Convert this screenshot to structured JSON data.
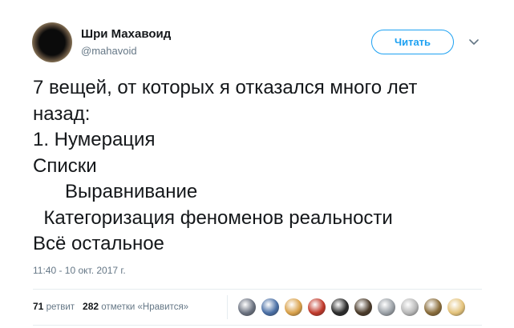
{
  "tweet": {
    "author_name": "Шри Махавоид",
    "author_handle": "@mahavoid",
    "follow_label": "Читать",
    "text_lines": [
      "7 вещей, от которых я отказался много лет",
      "назад:",
      "1. Нумерация",
      "Списки",
      "      Выравнивание",
      "  Категоризация феноменов реальности",
      "Всё остальное"
    ],
    "timestamp": "11:40 - 10 окт. 2017 г.",
    "retweets_count": "71",
    "retweets_label": "ретвит",
    "likes_count": "282",
    "likes_label": "отметки «Нравится»",
    "liker_avatars": [
      {
        "icon": "avatar-1",
        "color": "#6b7280"
      },
      {
        "icon": "avatar-2",
        "color": "#4a6fa5"
      },
      {
        "icon": "avatar-3",
        "color": "#d9a14a"
      },
      {
        "icon": "avatar-4",
        "color": "#c0392b"
      },
      {
        "icon": "avatar-5",
        "color": "#2b2b2b"
      },
      {
        "icon": "avatar-6",
        "color": "#4b3b2a"
      },
      {
        "icon": "avatar-7",
        "color": "#9aa0a6"
      },
      {
        "icon": "avatar-8",
        "color": "#b7b7b7"
      },
      {
        "icon": "avatar-9",
        "color": "#8a6d3b"
      },
      {
        "icon": "avatar-10",
        "color": "#e3c27a"
      }
    ],
    "accent_color": "#1da1f2"
  }
}
